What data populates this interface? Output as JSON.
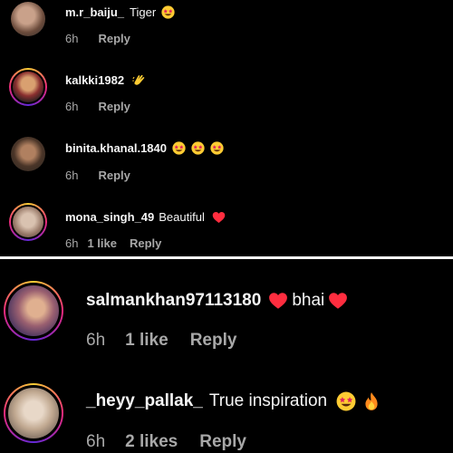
{
  "top_comments": [
    {
      "username": "m.r_baiju_",
      "text": "Tiger",
      "emojis": [
        "star-struck"
      ],
      "time": "6h",
      "likes": "",
      "reply": "Reply",
      "avatar_ring": false
    },
    {
      "username": "kalkki1982",
      "text": "",
      "emojis": [
        "clapping-hands"
      ],
      "time": "6h",
      "likes": "",
      "reply": "Reply",
      "avatar_ring": true
    },
    {
      "username": "binita.khanal.1840",
      "text": "",
      "emojis": [
        "star-struck",
        "star-struck",
        "star-struck"
      ],
      "time": "6h",
      "likes": "",
      "reply": "Reply",
      "avatar_ring": false
    },
    {
      "username": "mona_singh_49",
      "text": "Beautiful",
      "emojis": [
        "red-heart"
      ],
      "time": "6h",
      "likes": "1 like",
      "reply": "Reply",
      "avatar_ring": true
    }
  ],
  "bottom_comments": [
    {
      "username": "salmankhan97113180",
      "text": "bhai",
      "time": "6h",
      "likes": "1 like",
      "reply": "Reply",
      "avatar_ring": true
    },
    {
      "username": "_heyy_pallak_",
      "text": "True inspiration",
      "time": "6h",
      "likes": "2 likes",
      "reply": "Reply",
      "avatar_ring": true
    }
  ],
  "colors": {
    "background": "#000000",
    "text": "#f5f5f5",
    "meta": "#a8a8a8",
    "heart": "#ff2d3f",
    "emoji_face": "#ffcc33"
  }
}
